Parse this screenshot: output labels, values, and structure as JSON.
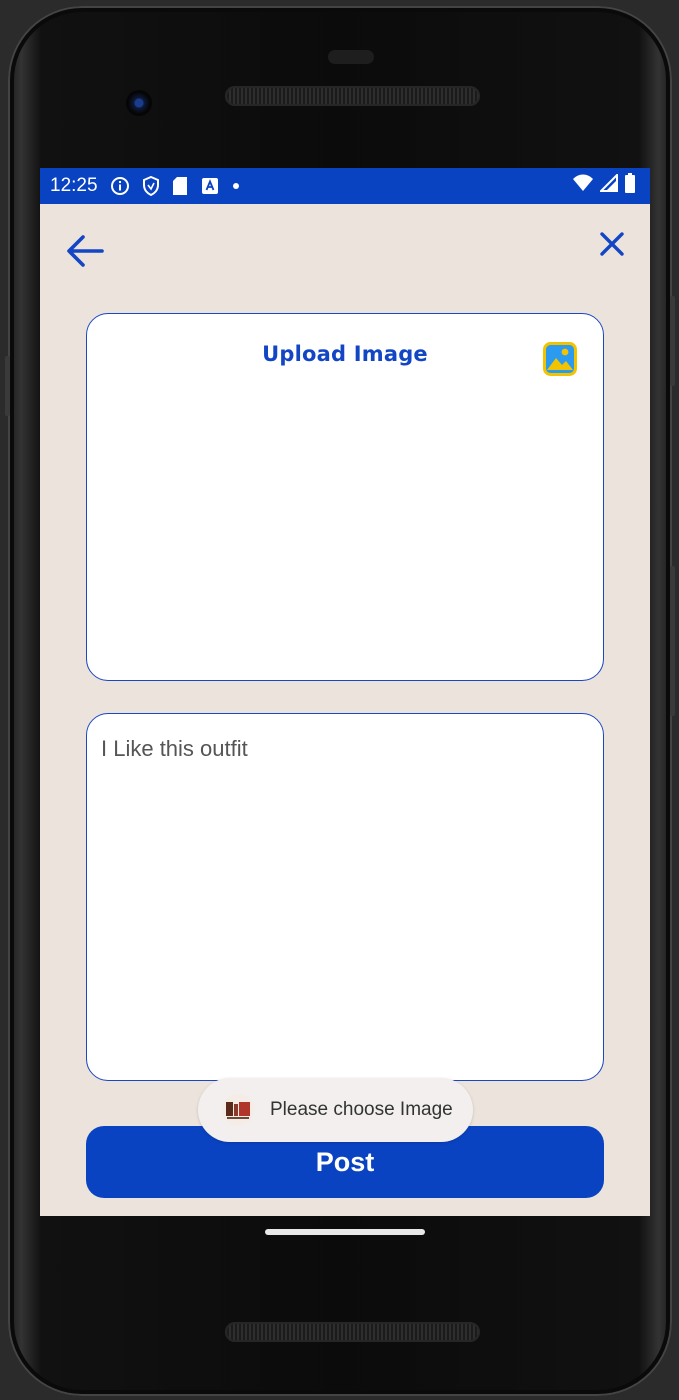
{
  "status_bar": {
    "time": "12:25",
    "icons": [
      "info-icon",
      "shield-icon",
      "sd-card-icon",
      "a-badge-icon",
      "dot-icon"
    ],
    "right_icons": [
      "wifi-icon",
      "signal-icon",
      "battery-icon"
    ]
  },
  "app_bar": {
    "back_icon": "arrow-left-icon",
    "close_icon": "close-icon"
  },
  "upload": {
    "title": "Upload Image",
    "icon": "image-icon"
  },
  "caption": {
    "value": "I Like this outfit"
  },
  "post_button": {
    "label": "Post"
  },
  "toast": {
    "message": "Please choose Image"
  },
  "colors": {
    "primary": "#0a43c2",
    "background": "#ebe3dc",
    "card": "#ffffff",
    "border": "#1a47c4"
  }
}
